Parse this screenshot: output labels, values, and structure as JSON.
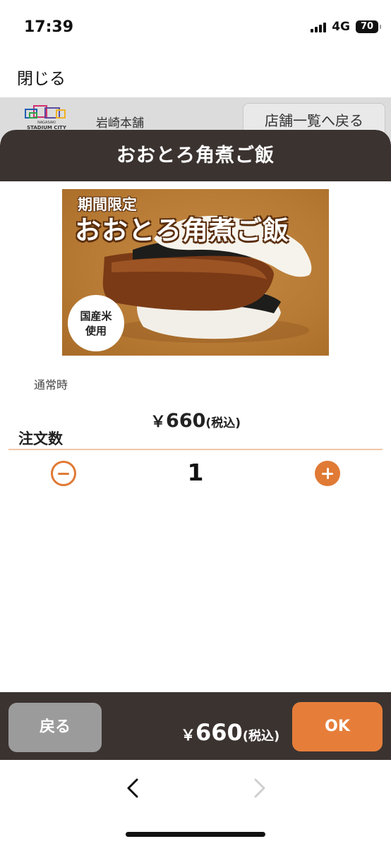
{
  "status": {
    "time": "17:39",
    "network": "4G",
    "battery": "70"
  },
  "nav": {
    "close_label": "閉じる"
  },
  "store": {
    "name": "岩崎本舗",
    "back_to_list_label": "店舗一覧へ戻る",
    "logo_text": "NAGASAKI STADIUM CITY"
  },
  "product": {
    "title": "おおとろ角煮ご飯",
    "image_sub_text": "期間限定",
    "image_main_text": "おおとろ角煮ご飯",
    "image_badge_line1": "国産米",
    "image_badge_line2": "使用",
    "normal_label": "通常時",
    "price_symbol": "￥",
    "price_value": "660",
    "price_tax": "(税込)"
  },
  "quantity": {
    "label": "注文数",
    "value": "1",
    "minus_icon": "minus-circle-icon",
    "plus_icon": "plus-circle-icon"
  },
  "footer": {
    "back_label": "戻る",
    "total_symbol": "￥",
    "total_value": "660",
    "total_tax": "(税込)",
    "ok_label": "OK"
  },
  "browser": {
    "back_icon": "chevron-left-icon",
    "forward_icon": "chevron-right-icon"
  },
  "colors": {
    "accent": "#e07a35",
    "bar": "#3b3330",
    "header_gray": "#dcdcdc",
    "button_gray": "#9b9b9b"
  }
}
